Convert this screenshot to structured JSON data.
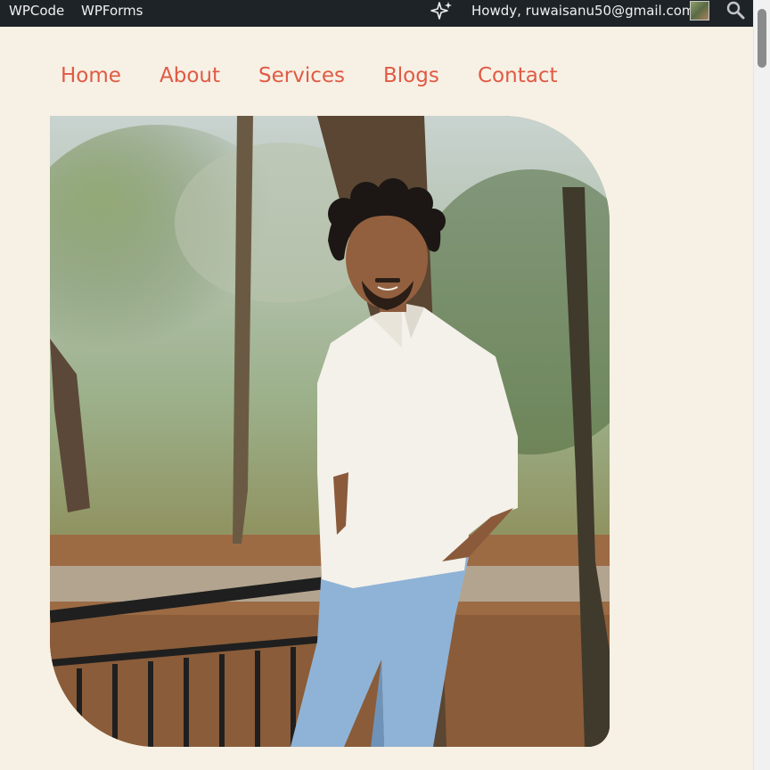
{
  "admin_bar": {
    "wpcode_label": "WPCode",
    "wpforms_label": "WPForms",
    "ai_icon": "sparkle-icon",
    "greeting": "Howdy, ruwaisanu50@gmail.com",
    "avatar_icon": "user-avatar",
    "search_icon": "search-icon",
    "background": "#1d2327"
  },
  "nav": {
    "items": [
      {
        "label": "Home"
      },
      {
        "label": "About"
      },
      {
        "label": "Services"
      },
      {
        "label": "Blogs"
      },
      {
        "label": "Contact"
      }
    ],
    "link_color": "#e05a45"
  },
  "hero": {
    "image_description": "photo-of-young-man-in-park"
  },
  "page": {
    "background": "#f7f0e4"
  }
}
